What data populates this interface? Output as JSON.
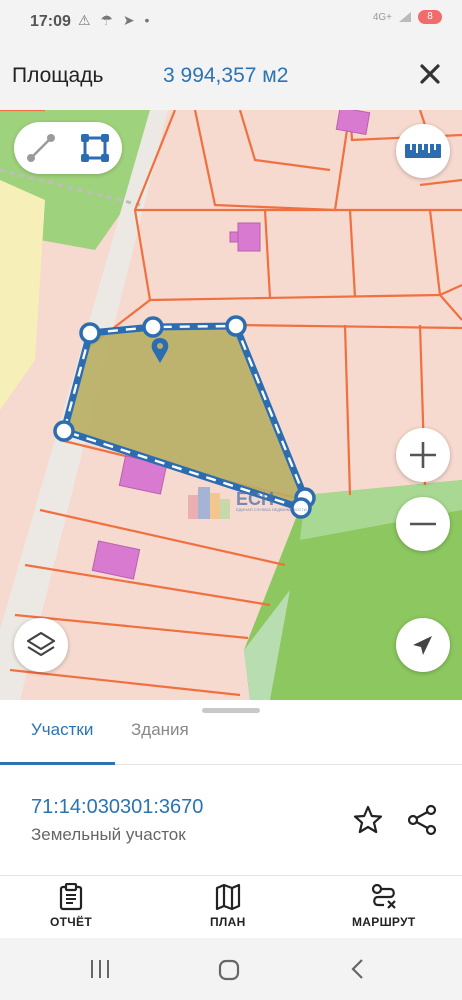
{
  "status_bar": {
    "time": "17:09",
    "left_icons": "⚠ ☂ ➤ •",
    "network": "4G+",
    "battery": "8"
  },
  "header": {
    "title": "Площадь",
    "area_value": "3 994,357 м2"
  },
  "map": {
    "watermark_title": "ЕСН",
    "watermark_subtitle": "ЕДИНАЯ СЛУЖБА НЕДВИЖИМОСТИ"
  },
  "sheet": {
    "tabs": [
      {
        "label": "Участки",
        "active": true
      },
      {
        "label": "Здания",
        "active": false
      }
    ],
    "parcel_id": "71:14:030301:3670",
    "parcel_type": "Земельный участок"
  },
  "bottom_nav": {
    "report_label": "ОТЧЁТ",
    "plan_label": "ПЛАН",
    "route_label": "МАРШРУТ"
  },
  "colors": {
    "accent": "#2b73b3",
    "polygon_fill": "#b8ae63",
    "parcel_line": "#f07040",
    "green_area": "#8cc75f",
    "building": "#d97ad1"
  }
}
